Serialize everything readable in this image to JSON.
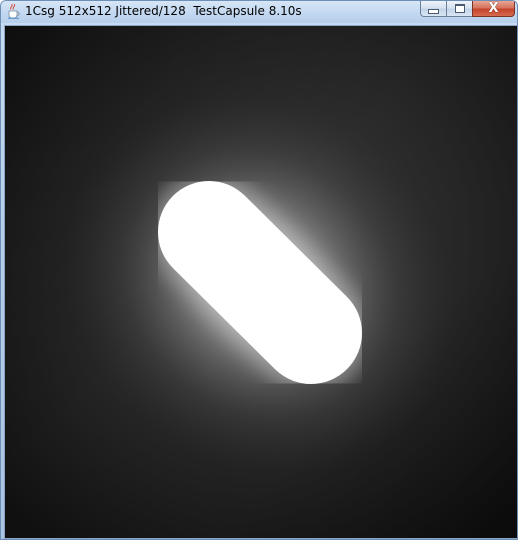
{
  "window": {
    "title": "1Csg 512x512 Jittered/128  TestCapsule 8.10s",
    "icon": "java-coffee-cup-icon",
    "buttons": {
      "minimize_icon": "minimize-icon",
      "maximize_icon": "maximize-icon",
      "close_label": "X"
    }
  },
  "render": {
    "background_color": "#141414",
    "shape": "capsule",
    "shape_color": "#ffffff"
  }
}
